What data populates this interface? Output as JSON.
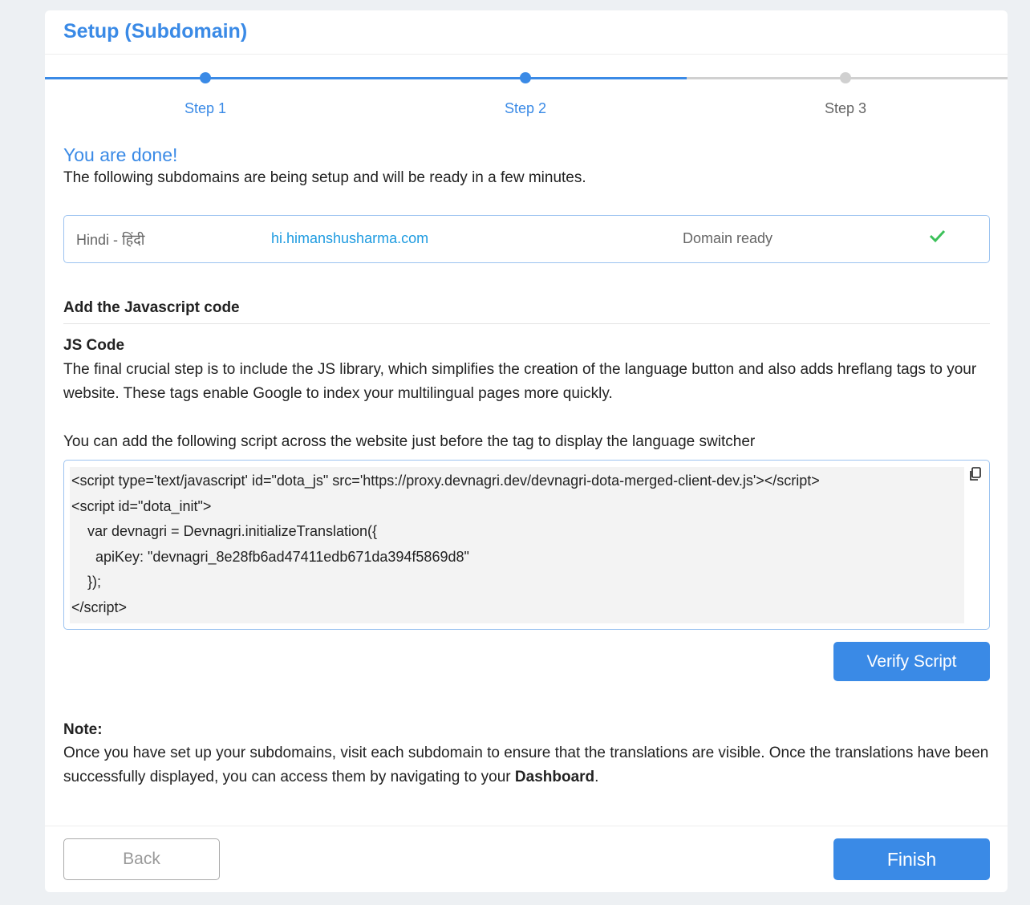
{
  "title": "Setup (Subdomain)",
  "steps": [
    {
      "label": "Step 1",
      "state": "complete"
    },
    {
      "label": "Step 2",
      "state": "complete"
    },
    {
      "label": "Step 3",
      "state": "pending"
    }
  ],
  "progress_percent": 66.7,
  "colors": {
    "accent": "#3a8ae6",
    "pending": "#d0d0d0",
    "success": "#3cc15a"
  },
  "done_heading": "You are done!",
  "done_text": "The following subdomains are being setup and will be ready in a few minutes.",
  "domain": {
    "language": "Hindi - हिंदी",
    "url": "hi.himanshusharma.com",
    "status": "Domain ready",
    "status_icon": "check-icon"
  },
  "section_title": "Add the Javascript code",
  "js_heading": "JS Code",
  "js_text": "The final crucial step is to include the JS library, which simplifies the creation of the language button and also adds hreflang tags to your website. These tags enable Google to index your multilingual pages more quickly.",
  "script_text": "You can add the following script across the website just before the tag to display the language switcher",
  "code": "<script type='text/javascript' id=\"dota_js\" src='https://proxy.devnagri.dev/devnagri-dota-merged-client-dev.js'></script>\n<script id=\"dota_init\">\n    var devnagri = Devnagri.initializeTranslation({\n      apiKey: \"devnagri_8e28fb6ad47411edb671da394f5869d8\"\n    });\n</script>",
  "verify_label": "Verify Script",
  "note_heading": "Note:",
  "note_text": "Once you have set up your subdomains, visit each subdomain to ensure that the translations are visible. Once the translations have been successfully displayed, you can access them by navigating to your ",
  "note_link": "Dashboard",
  "note_end": ".",
  "back_label": "Back",
  "finish_label": "Finish"
}
